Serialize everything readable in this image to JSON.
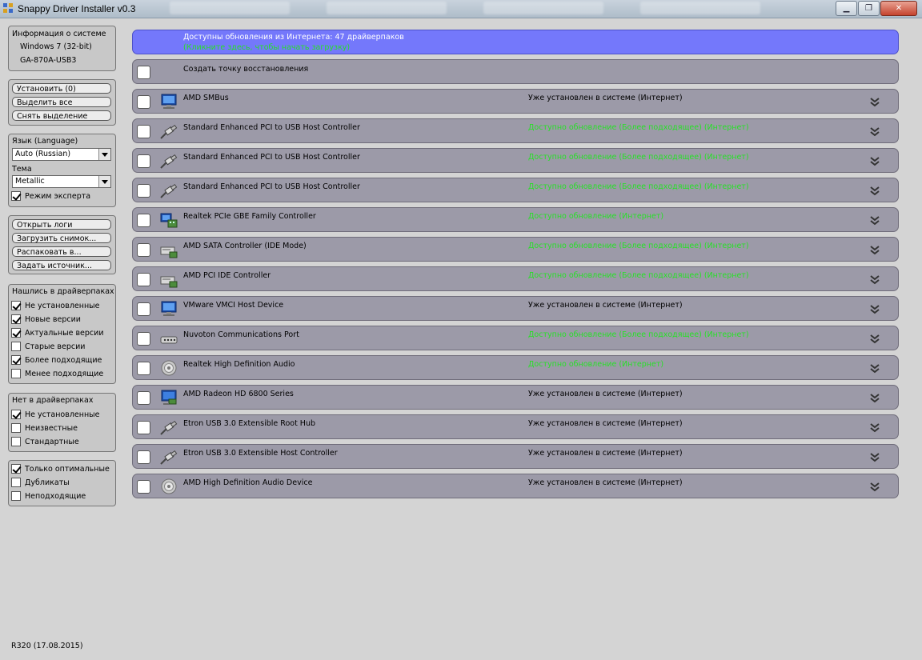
{
  "window": {
    "title": "Snappy Driver Installer v0.3",
    "buttons": {
      "minimize": "▁",
      "maximize": "❐",
      "close": "✕"
    }
  },
  "sysinfo": {
    "title": "Информация о системе",
    "os": "Windows 7 (32-bit)",
    "board": "GA-870A-USB3"
  },
  "actions": {
    "install": "Установить (0)",
    "select_all": "Выделить все",
    "deselect": "Снять выделение"
  },
  "settings": {
    "language_label": "Язык (Language)",
    "language_value": "Auto (Russian)",
    "theme_label": "Тема",
    "theme_value": "Metallic",
    "expert_mode": {
      "label": "Режим эксперта",
      "checked": true
    }
  },
  "tools": {
    "open_logs": "Открыть логи",
    "load_snapshot": "Загрузить снимок...",
    "extract": "Распаковать в...",
    "set_source": "Задать источник..."
  },
  "found_filter": {
    "title": "Нашлись в драйверпаках",
    "items": [
      {
        "label": "Не установленные",
        "checked": true
      },
      {
        "label": "Новые версии",
        "checked": true
      },
      {
        "label": "Актуальные версии",
        "checked": true
      },
      {
        "label": "Старые версии",
        "checked": false
      },
      {
        "label": "Более подходящие",
        "checked": true
      },
      {
        "label": "Менее подходящие",
        "checked": false
      }
    ]
  },
  "notfound_filter": {
    "title": "Нет в драйверпаках",
    "items": [
      {
        "label": "Не установленные",
        "checked": true
      },
      {
        "label": "Неизвестные",
        "checked": false
      },
      {
        "label": "Стандартные",
        "checked": false
      }
    ]
  },
  "extra_filter": {
    "items": [
      {
        "label": "Только оптимальные",
        "checked": true
      },
      {
        "label": "Дубликаты",
        "checked": false
      },
      {
        "label": "Неподходящие",
        "checked": false
      }
    ]
  },
  "banner": {
    "line1": "Доступны обновления из Интернета: 47 драйверпаков",
    "line2": "(Кликните здесь, чтобы начать загрузку)"
  },
  "restore_point": {
    "label": "Создать точку восстановления"
  },
  "devices": [
    {
      "name": "AMD SMBus",
      "status": "Уже установлен в системе (Интернет)",
      "kind": "installed",
      "icon": "monitor-icon"
    },
    {
      "name": "Standard Enhanced PCI to USB Host Controller",
      "status": "Доступно обновление (Более подходящее) (Интернет)",
      "kind": "update",
      "icon": "usb-plug-icon"
    },
    {
      "name": "Standard Enhanced PCI to USB Host Controller",
      "status": "Доступно обновление (Более подходящее) (Интернет)",
      "kind": "update",
      "icon": "usb-plug-icon"
    },
    {
      "name": "Standard Enhanced PCI to USB Host Controller",
      "status": "Доступно обновление (Более подходящее) (Интернет)",
      "kind": "update",
      "icon": "usb-plug-icon"
    },
    {
      "name": "Realtek PCIe GBE Family Controller",
      "status": "Доступно обновление (Интернет)",
      "kind": "update",
      "icon": "network-icon"
    },
    {
      "name": "AMD SATA Controller (IDE Mode)",
      "status": "Доступно обновление (Более подходящее) (Интернет)",
      "kind": "update",
      "icon": "disk-controller-icon"
    },
    {
      "name": "AMD PCI IDE Controller",
      "status": "Доступно обновление (Более подходящее) (Интернет)",
      "kind": "update",
      "icon": "disk-controller-icon"
    },
    {
      "name": "VMware VMCI Host Device",
      "status": "Уже установлен в системе (Интернет)",
      "kind": "installed",
      "icon": "monitor-icon"
    },
    {
      "name": "Nuvoton Communications Port",
      "status": "Доступно обновление (Более подходящее) (Интернет)",
      "kind": "update",
      "icon": "port-icon"
    },
    {
      "name": "Realtek High Definition Audio",
      "status": "Доступно обновление (Интернет)",
      "kind": "update",
      "icon": "speaker-icon"
    },
    {
      "name": "AMD Radeon HD 6800 Series",
      "status": "Уже установлен в системе (Интернет)",
      "kind": "installed",
      "icon": "display-adapter-icon"
    },
    {
      "name": "Etron USB 3.0 Extensible Root Hub",
      "status": "Уже установлен в системе (Интернет)",
      "kind": "installed",
      "icon": "usb-plug-icon"
    },
    {
      "name": "Etron USB 3.0 Extensible Host Controller",
      "status": "Уже установлен в системе (Интернет)",
      "kind": "installed",
      "icon": "usb-plug-icon"
    },
    {
      "name": "AMD High Definition Audio Device",
      "status": "Уже установлен в системе (Интернет)",
      "kind": "installed",
      "icon": "speaker-icon"
    }
  ],
  "footer": {
    "version": "R320 (17.08.2015)"
  }
}
